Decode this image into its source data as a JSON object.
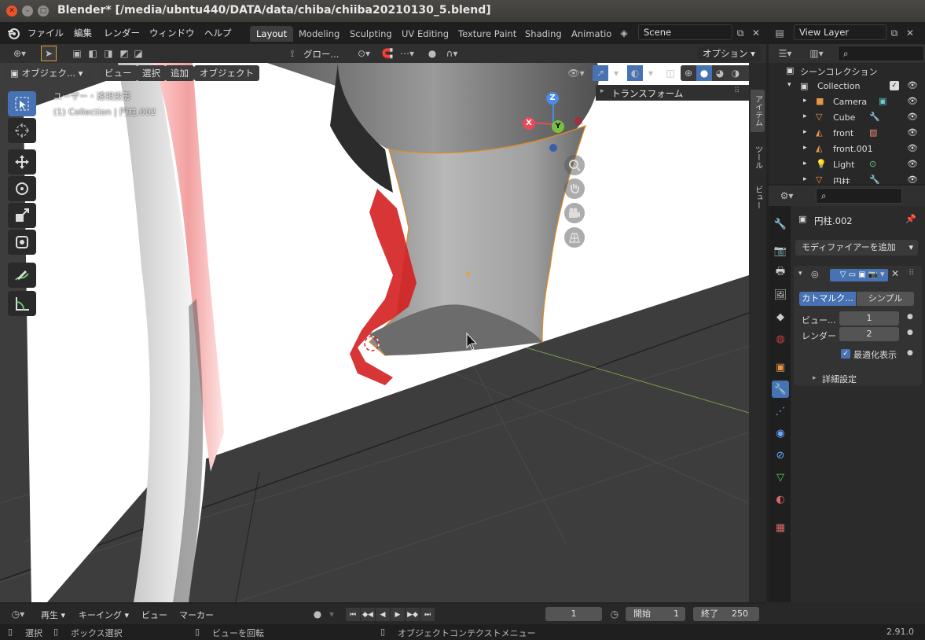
{
  "window": {
    "title": "Blender* [/media/ubntu440/DATA/data/chiba/chiiba20210130_5.blend]"
  },
  "menu": {
    "items": [
      "ファイル",
      "編集",
      "レンダー",
      "ウィンドウ",
      "ヘルプ"
    ]
  },
  "workspaces": {
    "tabs": [
      "Layout",
      "Modeling",
      "Sculpting",
      "UV Editing",
      "Texture Paint",
      "Shading",
      "Animatio"
    ],
    "active": "Layout"
  },
  "scene": {
    "name": "Scene"
  },
  "view_layer": {
    "name": "View Layer"
  },
  "viewport_header": {
    "transform_orientation": "グロー...",
    "options_label": "オプション",
    "mode_label": "オブジェク...",
    "menus": [
      "ビュー",
      "選択",
      "追加",
      "オブジェクト"
    ]
  },
  "viewport": {
    "overlay_line1": "ユーザー・透視投影",
    "overlay_line2": "(1) Collection | 円柱.002",
    "gizmo": {
      "x": "X",
      "y": "Y",
      "z": "Z"
    }
  },
  "n_panel": {
    "section_title": "トランスフォーム",
    "tabs": [
      "アイテム",
      "ツール",
      "ビュー"
    ]
  },
  "outliner": {
    "title": "シーンコレクション",
    "collection": "Collection",
    "items": [
      "Camera",
      "Cube",
      "front",
      "front.001",
      "Light",
      "円柱"
    ]
  },
  "properties": {
    "object_name": "円柱.002",
    "add_modifier": "モディファイアーを追加",
    "subdiv_type": {
      "catmull": "カトマルク...",
      "simple": "シンプル"
    },
    "levels_viewport_label": "ビュー...",
    "levels_viewport_value": "1",
    "render_label": "レンダー",
    "render_value": "2",
    "optimal_display": "最適化表示",
    "advanced": "詳細設定"
  },
  "timeline": {
    "playback": "再生",
    "keying": "キーイング",
    "view": "ビュー",
    "marker": "マーカー",
    "current_frame": "1",
    "start_label": "開始",
    "start_value": "1",
    "end_label": "終了",
    "end_value": "250"
  },
  "statusbar": {
    "select": "選択",
    "box_select": "ボックス選択",
    "rotate_view": "ビューを回転",
    "context_menu": "オブジェクトコンテクストメニュー",
    "version": "2.91.0"
  }
}
